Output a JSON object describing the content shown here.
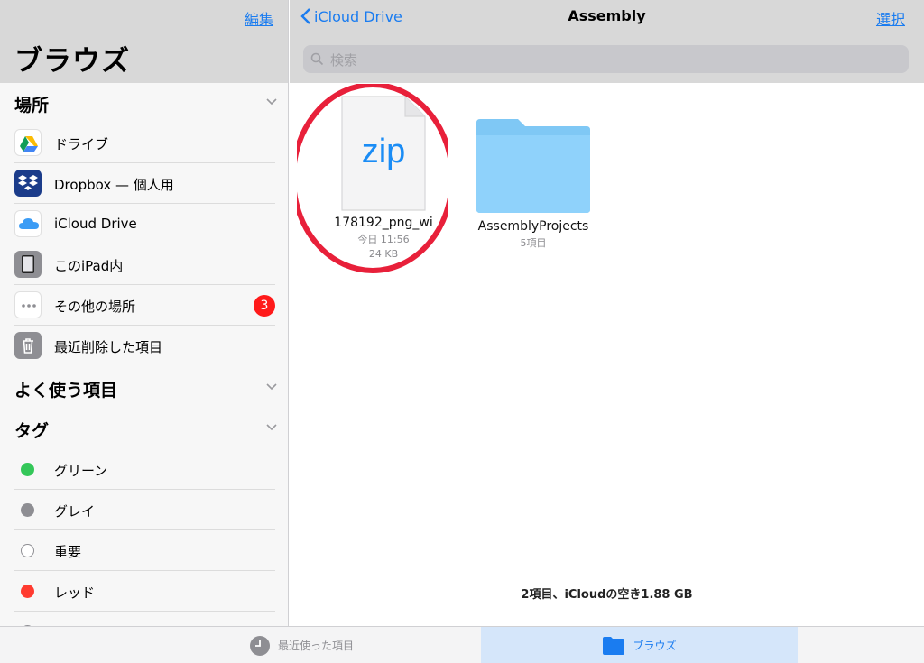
{
  "sidebar": {
    "edit_label": "編集",
    "title": "ブラウズ",
    "locations": {
      "header": "場所",
      "items": [
        {
          "label": "ドライブ",
          "icon": "google-drive-icon"
        },
        {
          "label": "Dropbox — 個人用",
          "icon": "dropbox-icon"
        },
        {
          "label": "iCloud Drive",
          "icon": "icloud-icon"
        },
        {
          "label": "このiPad内",
          "icon": "ipad-icon"
        },
        {
          "label": "その他の場所",
          "icon": "more-icon",
          "badge": "3"
        },
        {
          "label": "最近削除した項目",
          "icon": "trash-icon"
        }
      ]
    },
    "favorites": {
      "header": "よく使う項目"
    },
    "tags": {
      "header": "タグ",
      "items": [
        {
          "label": "グリーン",
          "color": "#34c759"
        },
        {
          "label": "グレイ",
          "color": "#8e8e93"
        },
        {
          "label": "重要",
          "color": "outline"
        },
        {
          "label": "レッド",
          "color": "#ff3b30"
        }
      ]
    }
  },
  "nav": {
    "back_label": "iCloud Drive",
    "title": "Assembly",
    "select_label": "選択"
  },
  "search": {
    "placeholder": "検索"
  },
  "files": [
    {
      "name": "178192_png_wi",
      "date": "今日 11:56",
      "size": "24 KB",
      "type_label": "zip",
      "highlight": "#e8203a"
    },
    {
      "name": "AssemblyProjects",
      "count": "5項目",
      "type": "folder",
      "color": "#7fc8f5"
    }
  ],
  "footer": {
    "summary": "2項目、iCloudの空き1.88 GB"
  },
  "tabbar": {
    "recent_label": "最近使った項目",
    "browse_label": "ブラウズ"
  },
  "colors": {
    "accent": "#1a7cf0",
    "badge": "#ff1a1a"
  }
}
